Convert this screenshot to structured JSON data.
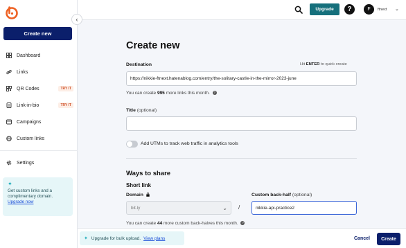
{
  "colors": {
    "brand_navy": "#0b1f6b",
    "upgrade_teal": "#16707c",
    "promo_bg": "#e6f6f8",
    "badge_orange": "#d0532b",
    "logo_orange": "#ee6123"
  },
  "sidebar": {
    "create_new_label": "Create new",
    "items": [
      {
        "label": "Dashboard",
        "icon": "dashboard-icon"
      },
      {
        "label": "Links",
        "icon": "link-icon"
      },
      {
        "label": "QR Codes",
        "icon": "qr-icon",
        "badge": "TRY IT"
      },
      {
        "label": "Link-in-bio",
        "icon": "link-in-bio-icon",
        "badge": "TRY IT"
      },
      {
        "label": "Campaigns",
        "icon": "campaigns-icon"
      },
      {
        "label": "Custom links",
        "icon": "custom-links-icon"
      },
      {
        "label": "Settings",
        "icon": "gear-icon"
      }
    ],
    "promo": {
      "text": "Get custom links and a complimentary domain.",
      "link": "Upgrade now"
    }
  },
  "topbar": {
    "upgrade_label": "Upgrade",
    "avatar_initial": "F",
    "user_name": "ftnext"
  },
  "form": {
    "title": "Create new",
    "destination_label": "Destination",
    "hint_pre": "Hit",
    "hint_key": "ENTER",
    "hint_post": "to quick create",
    "destination_value": "https://nikkie-ftnext.hatenablog.com/entry/the-solitary-castle-in-the-mirror-2023-june",
    "links_helper_pre": "You can create",
    "links_remaining": "995",
    "links_helper_post": "more links this month.",
    "title_label": "Title",
    "title_optional": "(optional)",
    "title_value": "",
    "utm_label": "Add UTMs to track web traffic in analytics tools",
    "utm_enabled": false,
    "ways_title": "Ways to share",
    "short_link_title": "Short link",
    "domain_label": "Domain",
    "domain_value": "bit.ly",
    "slash": "/",
    "backhalf_label": "Custom back-half",
    "backhalf_optional": "(optional)",
    "backhalf_value": "nikkie-api-practice2",
    "backhalf_helper_pre": "You can create",
    "backhalves_remaining": "44",
    "backhalf_helper_post": "more custom back-halves this month."
  },
  "bottombar": {
    "bulk_text": "Upgrade for bulk upload.",
    "bulk_link": "View plans",
    "cancel_label": "Cancel",
    "create_label": "Create"
  }
}
